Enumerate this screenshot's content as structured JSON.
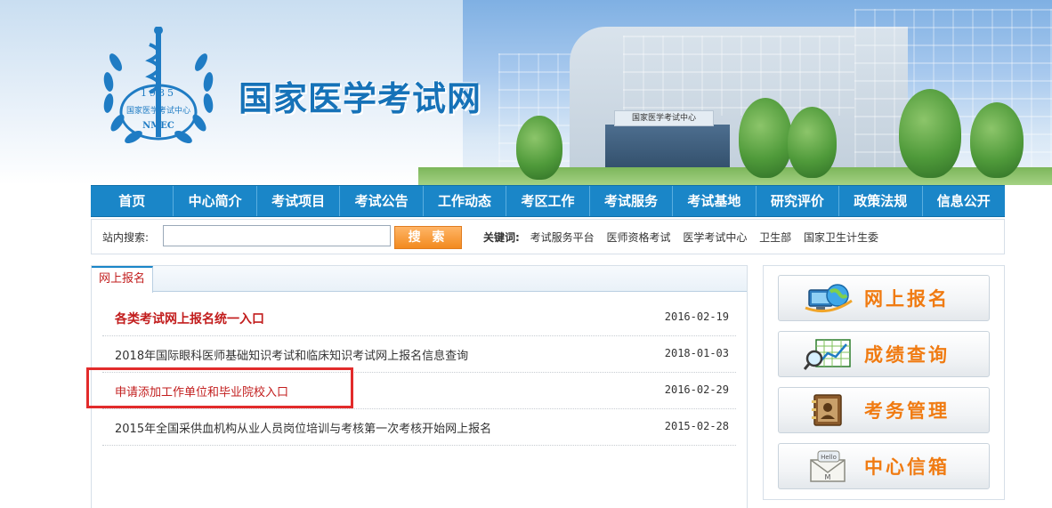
{
  "header": {
    "logo_year": "1985",
    "logo_org": "国家医学考试中心",
    "logo_abbr": "NMEC",
    "site_title": "国家医学考试网",
    "building_sign": "国家医学考试中心"
  },
  "nav": [
    "首页",
    "中心简介",
    "考试项目",
    "考试公告",
    "工作动态",
    "考区工作",
    "考试服务",
    "考试基地",
    "研究评价",
    "政策法规",
    "信息公开"
  ],
  "search": {
    "label": "站内搜索:",
    "value": "",
    "button_label": "搜 索",
    "keywords_label": "关键词:",
    "keywords": [
      "考试服务平台",
      "医师资格考试",
      "医学考试中心",
      "卫生部",
      "国家卫生计生委"
    ]
  },
  "panel": {
    "tab_label": "网上报名",
    "items": [
      {
        "title": "各类考试网上报名统一入口",
        "date": "2016-02-19",
        "style": "hot"
      },
      {
        "title": "2018年国际眼科医师基础知识考试和临床知识考试网上报名信息查询",
        "date": "2018-01-03",
        "style": "normal"
      },
      {
        "title": "申请添加工作单位和毕业院校入口",
        "date": "2016-02-29",
        "style": "red"
      },
      {
        "title": "2015年全国采供血机构从业人员岗位培训与考核第一次考核开始网上报名",
        "date": "2015-02-28",
        "style": "normal"
      }
    ]
  },
  "sidebar": [
    {
      "label": "网上报名",
      "icon": "globe-computer-icon"
    },
    {
      "label": "成绩查询",
      "icon": "chart-magnifier-icon"
    },
    {
      "label": "考务管理",
      "icon": "address-book-icon"
    },
    {
      "label": "中心信箱",
      "icon": "hello-mail-icon"
    }
  ],
  "colors": {
    "nav": "#1a86c8",
    "accent_orange": "#f07b12",
    "highlight_red": "#c21d1d"
  }
}
